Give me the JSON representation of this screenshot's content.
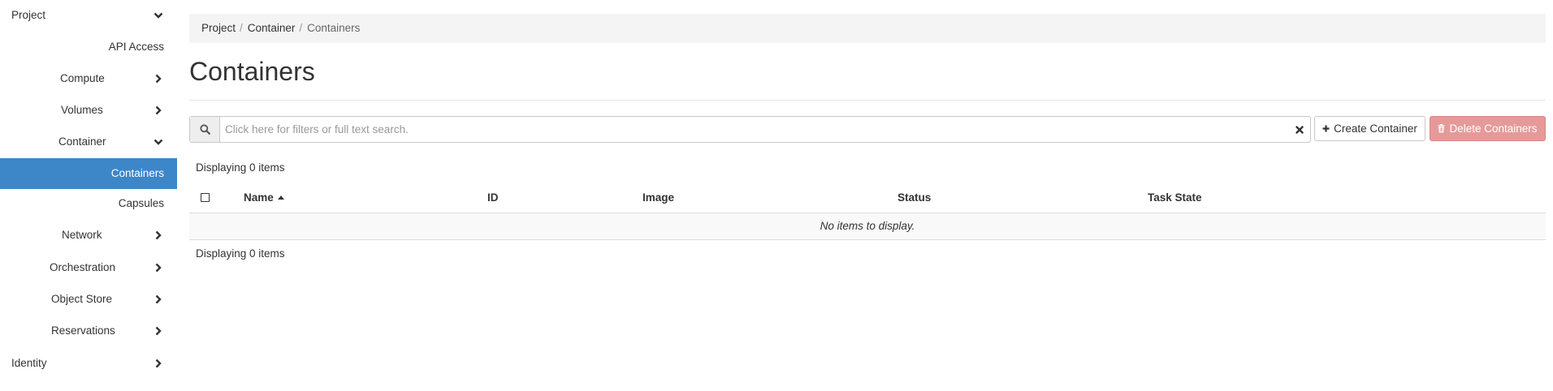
{
  "sidebar": {
    "items": [
      {
        "label": "Project",
        "chevron": "chevron-down-icon"
      },
      {
        "label": "API Access",
        "chevron": ""
      },
      {
        "label": "Compute",
        "chevron": "chevron-right-icon"
      },
      {
        "label": "Volumes",
        "chevron": "chevron-right-icon"
      },
      {
        "label": "Container",
        "chevron": "chevron-down-icon"
      },
      {
        "label": "Containers",
        "chevron": "",
        "active": true
      },
      {
        "label": "Capsules",
        "chevron": ""
      },
      {
        "label": "Network",
        "chevron": "chevron-right-icon"
      },
      {
        "label": "Orchestration",
        "chevron": "chevron-right-icon"
      },
      {
        "label": "Object Store",
        "chevron": "chevron-right-icon"
      },
      {
        "label": "Reservations",
        "chevron": "chevron-right-icon"
      },
      {
        "label": "Identity",
        "chevron": "chevron-right-icon"
      }
    ]
  },
  "breadcrumb": {
    "items": [
      "Project",
      "Container"
    ],
    "current": "Containers",
    "separator": "/"
  },
  "page": {
    "title": "Containers"
  },
  "search": {
    "placeholder": "Click here for filters or full text search.",
    "value": "",
    "icon": "search-icon",
    "clear_icon": "close-icon"
  },
  "actions": {
    "create_label": "Create Container",
    "create_icon": "plus-icon",
    "delete_label": "Delete Containers",
    "delete_icon": "trash-icon"
  },
  "table": {
    "count_top": "Displaying 0 items",
    "count_bottom": "Displaying 0 items",
    "columns": [
      "Name",
      "ID",
      "Image",
      "Status",
      "Task State"
    ],
    "sort_icon": "sort-up-icon",
    "empty_message": "No items to display."
  },
  "colors": {
    "active_nav": "#3d86c8",
    "danger_button": "#e59a99",
    "breadcrumb_bg": "#f4f4f4"
  }
}
